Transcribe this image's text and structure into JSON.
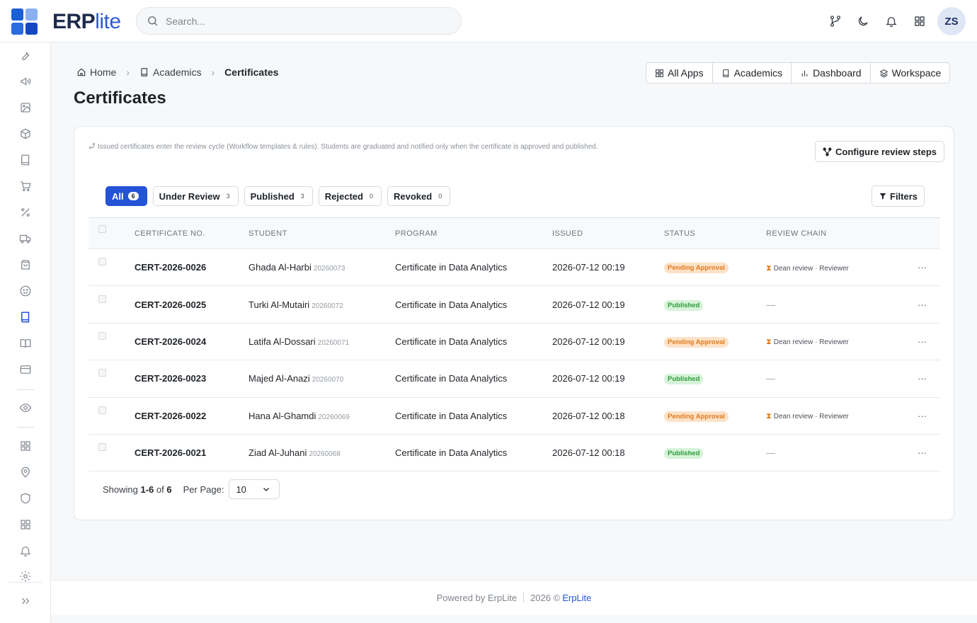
{
  "brand": {
    "name_bold": "ERP",
    "name_light": "lite",
    "colors": [
      "#1a5fd6",
      "#8ab0f2",
      "#2a6be0",
      "#1448c2"
    ]
  },
  "search": {
    "placeholder": "Search..."
  },
  "topbar_icons": [
    "git-branch-icon",
    "moon-icon",
    "bell-icon",
    "grid-icon"
  ],
  "user": {
    "initials": "ZS"
  },
  "sidebar": {
    "icons": [
      "wrench-icon",
      "megaphone-icon",
      "image-icon",
      "box-icon",
      "book-icon",
      "cart-icon",
      "percent-icon",
      "truck-icon",
      "shopping-bag-icon",
      "smile-icon",
      "book-active-icon",
      "book-open-icon",
      "credit-card-icon",
      "eye-icon",
      "apps-icon",
      "map-pin-icon",
      "shield-icon",
      "apps-2-icon",
      "bell-icon",
      "settings-icon",
      "expand-icon"
    ]
  },
  "breadcrumb": {
    "home": "Home",
    "academics": "Academics",
    "current": "Certificates"
  },
  "page": {
    "title": "Certificates"
  },
  "app_links": [
    {
      "label": "All Apps",
      "icon": "grid-icon"
    },
    {
      "label": "Academics",
      "icon": "book-icon"
    },
    {
      "label": "Dashboard",
      "icon": "bar-chart-icon"
    },
    {
      "label": "Workspace",
      "icon": "layers-icon"
    }
  ],
  "notice": {
    "text": "Issued certificates enter the review cycle (Workflow templates & rules). Students are graduated and notified only when the certificate is approved and published."
  },
  "config_button": {
    "label": "Configure review steps"
  },
  "tabs": [
    {
      "label": "All",
      "count": "6",
      "active": true
    },
    {
      "label": "Under Review",
      "count": "3"
    },
    {
      "label": "Published",
      "count": "3"
    },
    {
      "label": "Rejected",
      "count": "0"
    },
    {
      "label": "Revoked",
      "count": "0"
    }
  ],
  "filters": {
    "label": "Filters"
  },
  "table": {
    "headers": {
      "cert_no": "CERTIFICATE NO.",
      "student": "STUDENT",
      "program": "PROGRAM",
      "issued": "ISSUED",
      "status": "STATUS",
      "review_chain": "REVIEW CHAIN"
    },
    "rows": [
      {
        "cert_no": "CERT-2026-0026",
        "student": "Ghada Al-Harbi",
        "student_id": "20260073",
        "program": "Certificate in Data Analytics",
        "issued": "2026-07-12 00:19",
        "status": "Pending Approval",
        "status_type": "pending",
        "chain": "Dean review · Reviewer"
      },
      {
        "cert_no": "CERT-2026-0025",
        "student": "Turki Al-Mutairi",
        "student_id": "20260072",
        "program": "Certificate in Data Analytics",
        "issued": "2026-07-12 00:19",
        "status": "Published",
        "status_type": "published",
        "chain": "—"
      },
      {
        "cert_no": "CERT-2026-0024",
        "student": "Latifa Al-Dossari",
        "student_id": "20260071",
        "program": "Certificate in Data Analytics",
        "issued": "2026-07-12 00:19",
        "status": "Pending Approval",
        "status_type": "pending",
        "chain": "Dean review · Reviewer"
      },
      {
        "cert_no": "CERT-2026-0023",
        "student": "Majed Al-Anazi",
        "student_id": "20260070",
        "program": "Certificate in Data Analytics",
        "issued": "2026-07-12 00:19",
        "status": "Published",
        "status_type": "published",
        "chain": "—"
      },
      {
        "cert_no": "CERT-2026-0022",
        "student": "Hana Al-Ghamdi",
        "student_id": "20260069",
        "program": "Certificate in Data Analytics",
        "issued": "2026-07-12 00:18",
        "status": "Pending Approval",
        "status_type": "pending",
        "chain": "Dean review · Reviewer"
      },
      {
        "cert_no": "CERT-2026-0021",
        "student": "Ziad Al-Juhani",
        "student_id": "20260068",
        "program": "Certificate in Data Analytics",
        "issued": "2026-07-12 00:18",
        "status": "Published",
        "status_type": "published",
        "chain": "—"
      }
    ]
  },
  "pagination": {
    "showing_label": "Showing",
    "range": "1-6",
    "of_label": "of",
    "total": "6",
    "per_page_label": "Per Page:",
    "per_page": "10"
  },
  "footer": {
    "powered": "Powered by ErpLite",
    "year": "2026 ©",
    "link": "ErpLite"
  }
}
